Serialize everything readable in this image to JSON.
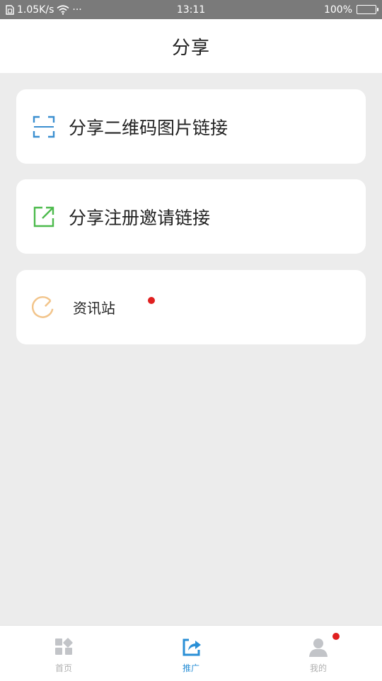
{
  "status_bar": {
    "network_speed": "1.05K/s",
    "dots": "···",
    "time": "13:11",
    "battery": "100%",
    "battery_level": 1.0
  },
  "header": {
    "title": "分享"
  },
  "cards": [
    {
      "label": "分享二维码图片链接",
      "icon": "qr-scan-icon",
      "icon_color": "#3b8fd0"
    },
    {
      "label": "分享注册邀请链接",
      "icon": "external-link-icon",
      "icon_color": "#4cba4c"
    },
    {
      "label": "资讯站",
      "icon": "refresh-circle-icon",
      "icon_color": "#f2c48a",
      "badge": true
    }
  ],
  "tab_bar": {
    "tabs": [
      {
        "label": "首页",
        "icon": "grid-icon",
        "active": false
      },
      {
        "label": "推广",
        "icon": "share-icon",
        "active": true
      },
      {
        "label": "我的",
        "icon": "user-icon",
        "active": false,
        "badge": true
      }
    ]
  },
  "colors": {
    "background": "#ececec",
    "accent": "#2a8fd6",
    "badge": "#e02020",
    "tab_inactive": "#b0b0b0"
  }
}
